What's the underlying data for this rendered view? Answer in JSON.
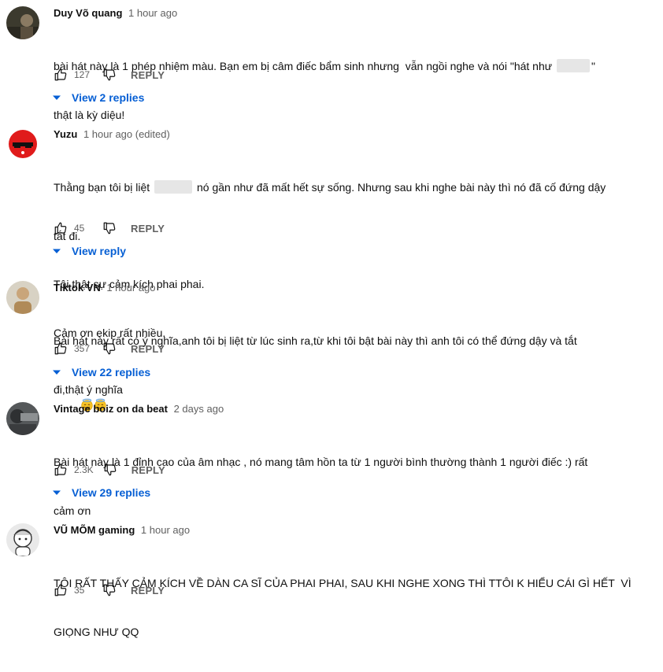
{
  "comments": [
    {
      "author": "Duy Võ quang",
      "time": "1 hour ago",
      "lines": [
        "bài hát này là 1 phép nhiệm màu. Bạn em bị câm điếc bẩm sinh nhưng  vẫn ngồi nghe và nói \"hát như",
        "thật là kỳ diệu!"
      ],
      "likes": "127",
      "reply_label": "REPLY",
      "view_replies": "View 2 replies"
    },
    {
      "author": "Yuzu",
      "time": "1 hour ago (edited)",
      "lines": [
        "Thằng bạn tôi bị liệt",
        "nó gần như đã mất hết sự sống. Nhưng sau khi nghe bài này thì nó đã cố đứng dậy",
        "tắt đi.",
        "Tôi thật sự cảm kích phai phai.",
        "Cảm ơn ekip rất nhiều."
      ],
      "likes": "45",
      "reply_label": "REPLY",
      "view_replies": "View reply"
    },
    {
      "author": "Tiktok VN",
      "time": "1 hour ago",
      "lines": [
        "Bài hát này rất có ý nghĩa,anh tôi bị liệt từ lúc sinh ra,từ khi tôi bật bài này thì anh tôi có thể đứng dậy và tắt",
        "đi,thật ý nghĩa"
      ],
      "likes": "357",
      "reply_label": "REPLY",
      "view_replies": "View 22 replies"
    },
    {
      "author": "Vintage boiz on da beat",
      "time": "2 days ago",
      "lines": [
        "Bài hát này là 1 đỉnh cao của âm nhạc , nó mang tâm hồn ta từ 1 người bình thường thành 1 người điếc :) rất",
        "cảm ơn"
      ],
      "likes": "2.3K",
      "reply_label": "REPLY",
      "view_replies": "View 29 replies"
    },
    {
      "author": "VŨ MÕM gaming",
      "time": "1 hour ago",
      "lines": [
        "TÔI RẤT THẤY CẢM KÍCH VỀ DÀN CA SĨ CỦA PHAI PHAI, SAU KHI NGHE XONG THÌ TTÔI K HIỂU CÁI GÌ HẾT  VÌ",
        "GIỌNG NHƯ QQ"
      ],
      "likes": "35",
      "reply_label": "REPLY"
    }
  ],
  "icons": {
    "like": "thumbs-up-icon",
    "dislike": "thumbs-down-icon",
    "expand": "chevron-down-icon",
    "emoji": "smiling-face-with-halo"
  },
  "colors": {
    "link": "#065fd4",
    "meta": "#606060",
    "text": "#0f0f0f"
  }
}
